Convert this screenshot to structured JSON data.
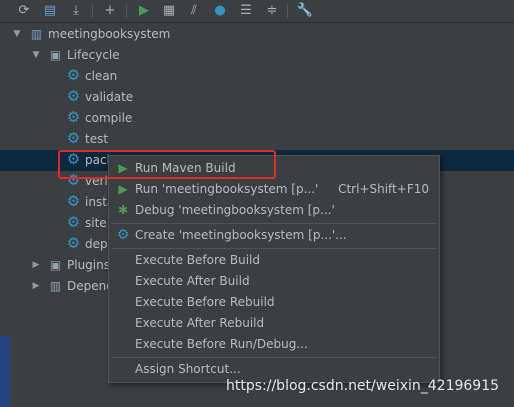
{
  "toolbar": {
    "icons": [
      "refresh-icon",
      "reimport-folder-icon",
      "download-sources-icon",
      "add-icon",
      "run-icon",
      "execute-goal-icon",
      "toggle-offline-icon",
      "skip-tests-icon",
      "show-dependencies-icon",
      "collapse-all-icon",
      "settings-wrench-icon"
    ]
  },
  "tree": {
    "project": "meetingbooksystem",
    "lifecycle": "Lifecycle",
    "phases": [
      "clean",
      "validate",
      "compile",
      "test",
      "pack",
      "veri",
      "insta",
      "site",
      "dep"
    ],
    "plugins": "Plugins",
    "dependencies": "Depend"
  },
  "context_menu": {
    "items": [
      {
        "label": "Run Maven Build",
        "shortcut": ""
      },
      {
        "label": "Run 'meetingbooksystem [p...'",
        "shortcut": "Ctrl+Shift+F10"
      },
      {
        "label": "Debug 'meetingbooksystem [p...'",
        "shortcut": ""
      },
      {
        "label": "Create 'meetingbooksystem [p...'...",
        "shortcut": ""
      },
      {
        "label": "Execute Before Build",
        "shortcut": ""
      },
      {
        "label": "Execute After Build",
        "shortcut": ""
      },
      {
        "label": "Execute Before Rebuild",
        "shortcut": ""
      },
      {
        "label": "Execute After Rebuild",
        "shortcut": ""
      },
      {
        "label": "Execute Before Run/Debug...",
        "shortcut": ""
      },
      {
        "label": "Assign Shortcut...",
        "shortcut": ""
      }
    ]
  },
  "watermark": "https://blog.csdn.net/weixin_42196915",
  "colors": {
    "selection": "#0d293e",
    "highlight_box": "#e02b2b",
    "gear": "#3592c4",
    "run": "#499c54"
  }
}
